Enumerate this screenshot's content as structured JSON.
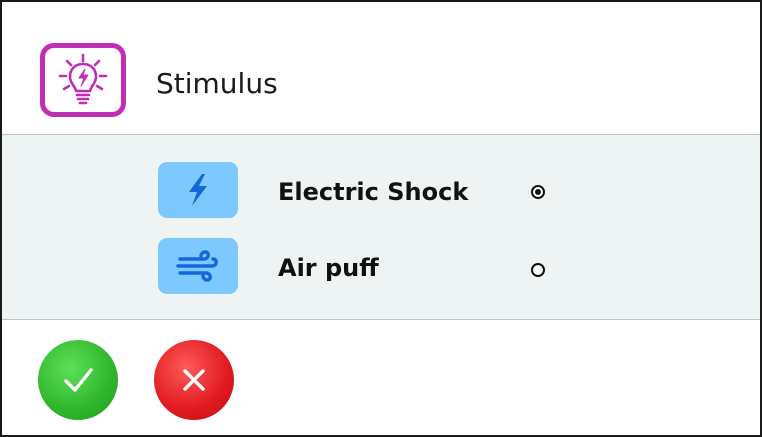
{
  "dialog": {
    "title": "Stimulus",
    "title_icon": "lightbulb-icon"
  },
  "options": [
    {
      "label": "Electric Shock",
      "icon": "lightning-icon",
      "selected": true
    },
    {
      "label": "Air puff",
      "icon": "wind-icon",
      "selected": false
    }
  ],
  "actions": {
    "confirm_icon": "checkmark-icon",
    "cancel_icon": "x-icon"
  },
  "colors": {
    "accent_magenta": "#c02eb6",
    "option_icon_bg": "#7cc8ff",
    "option_icon_fg": "#1467d9",
    "confirm_green": "#2fb52b",
    "cancel_red": "#e0191f",
    "options_band_bg": "#eef4f4"
  }
}
